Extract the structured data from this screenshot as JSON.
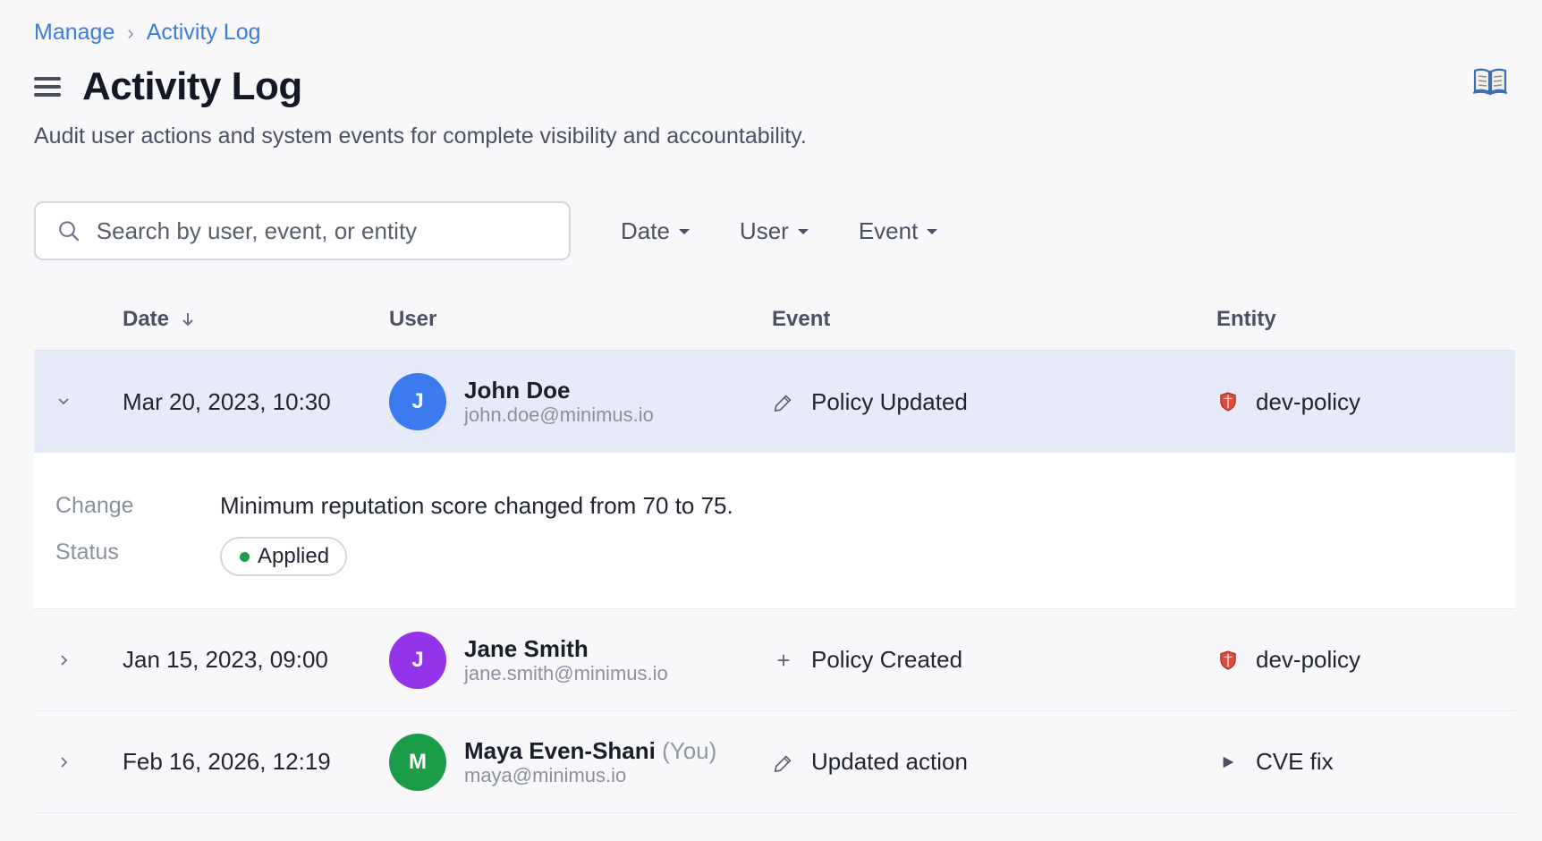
{
  "breadcrumb": {
    "parent": "Manage",
    "separator": "›",
    "current": "Activity Log"
  },
  "header": {
    "title": "Activity Log",
    "subtitle": "Audit user actions and system events for complete visibility and accountability."
  },
  "search": {
    "placeholder": "Search by user, event, or entity",
    "value": ""
  },
  "filters": {
    "date": "Date",
    "user": "User",
    "event": "Event"
  },
  "table": {
    "columns": {
      "date": "Date",
      "user": "User",
      "event": "Event",
      "entity": "Entity"
    },
    "rows": [
      {
        "date": "Mar 20, 2023, 10:30",
        "avatar_initial": "J",
        "avatar_color": "#3b7bef",
        "user_name": "John Doe",
        "user_tag": "",
        "user_email": "john.doe@minimus.io",
        "event_icon": "pencil-icon",
        "event": "Policy Updated",
        "entity_icon": "shield-icon",
        "entity": "dev-policy",
        "expanded": true
      },
      {
        "date": "Jan 15, 2023, 09:00",
        "avatar_initial": "J",
        "avatar_color": "#9333ea",
        "user_name": "Jane Smith",
        "user_tag": "",
        "user_email": "jane.smith@minimus.io",
        "event_icon": "plus-icon",
        "event": "Policy Created",
        "entity_icon": "shield-icon",
        "entity": "dev-policy",
        "expanded": false
      },
      {
        "date": "Feb 16, 2026, 12:19",
        "avatar_initial": "M",
        "avatar_color": "#1a9c48",
        "user_name": "Maya Even-Shani",
        "user_tag": "(You)",
        "user_email": "maya@minimus.io",
        "event_icon": "pencil-icon",
        "event": "Updated action",
        "entity_icon": "play-icon",
        "entity": "CVE fix",
        "expanded": false
      }
    ]
  },
  "detail": {
    "change_label": "Change",
    "change_value": "Minimum reputation score changed from 70 to 75.",
    "status_label": "Status",
    "status_value": "Applied",
    "status_color": "#1f9d4b"
  }
}
